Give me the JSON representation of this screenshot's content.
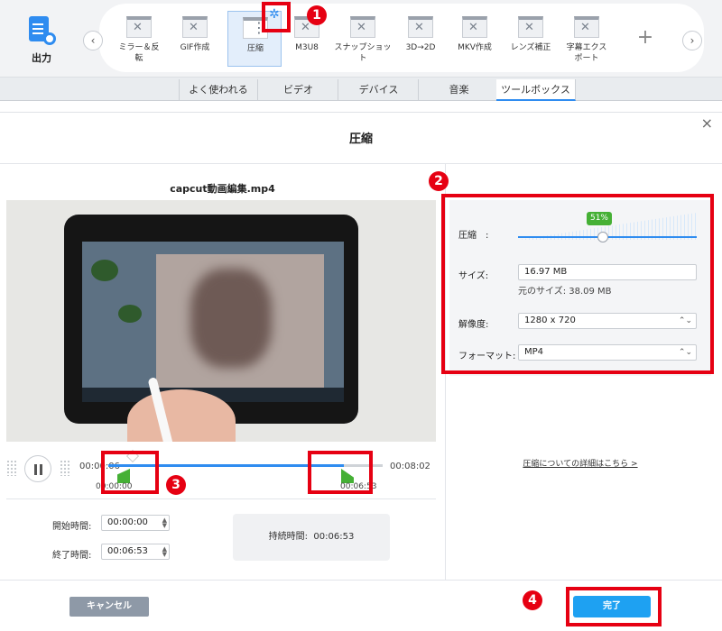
{
  "output": {
    "label": "出力"
  },
  "toolbar": {
    "tools": [
      {
        "label": "ミラー＆反\n転"
      },
      {
        "label": "GIF作成"
      },
      {
        "label": "圧縮"
      },
      {
        "label": "M3U8"
      },
      {
        "label": "スナップショッ\nト"
      },
      {
        "label": "3D→2D"
      },
      {
        "label": "MKV作成"
      },
      {
        "label": "レンズ補正"
      },
      {
        "label": "字幕エクス\nポート"
      }
    ],
    "active_tool": "圧縮",
    "add_label": "+",
    "prev_arrow": "‹",
    "next_arrow": "›"
  },
  "tabs": [
    {
      "label": "よく使われる"
    },
    {
      "label": "ビデオ"
    },
    {
      "label": "デバイス"
    },
    {
      "label": "音楽"
    },
    {
      "label": "ツールボックス"
    }
  ],
  "active_tab": "ツールボックス",
  "dialog": {
    "title": "圧縮",
    "close": "×",
    "filename": "capcut動画編集.mp4"
  },
  "timeline": {
    "current": "00:00:06",
    "total": "00:08:02",
    "clip_start": "00:00:00",
    "clip_end": "00:06:53",
    "progress": 0.86
  },
  "trim": {
    "start_label": "開始時間:",
    "start_value": "00:00:00",
    "end_label": "終了時間:",
    "end_value": "00:06:53",
    "duration_label": "持続時間:",
    "duration_value": "00:06:53"
  },
  "settings": {
    "compress_label": "圧縮　:",
    "compress_pct": "51%",
    "compress_value": 0.51,
    "size_label": "サイズ:",
    "size_value": "16.97  MB",
    "orig_size": "元のサイズ: 38.09 MB",
    "resolution_label": "解像度:",
    "resolution_value": "1280 x 720",
    "format_label": "フォーマット:",
    "format_value": "MP4",
    "more_link": "圧縮についての詳細はこちら >"
  },
  "buttons": {
    "cancel": "キャンセル",
    "done": "完了"
  },
  "annotations": [
    "1",
    "2",
    "3",
    "4"
  ],
  "colors": {
    "accent": "#2f8cf0",
    "annotation": "#e60012",
    "done": "#1ea1f2",
    "cancel": "#8e99a7",
    "green": "#45b035"
  }
}
